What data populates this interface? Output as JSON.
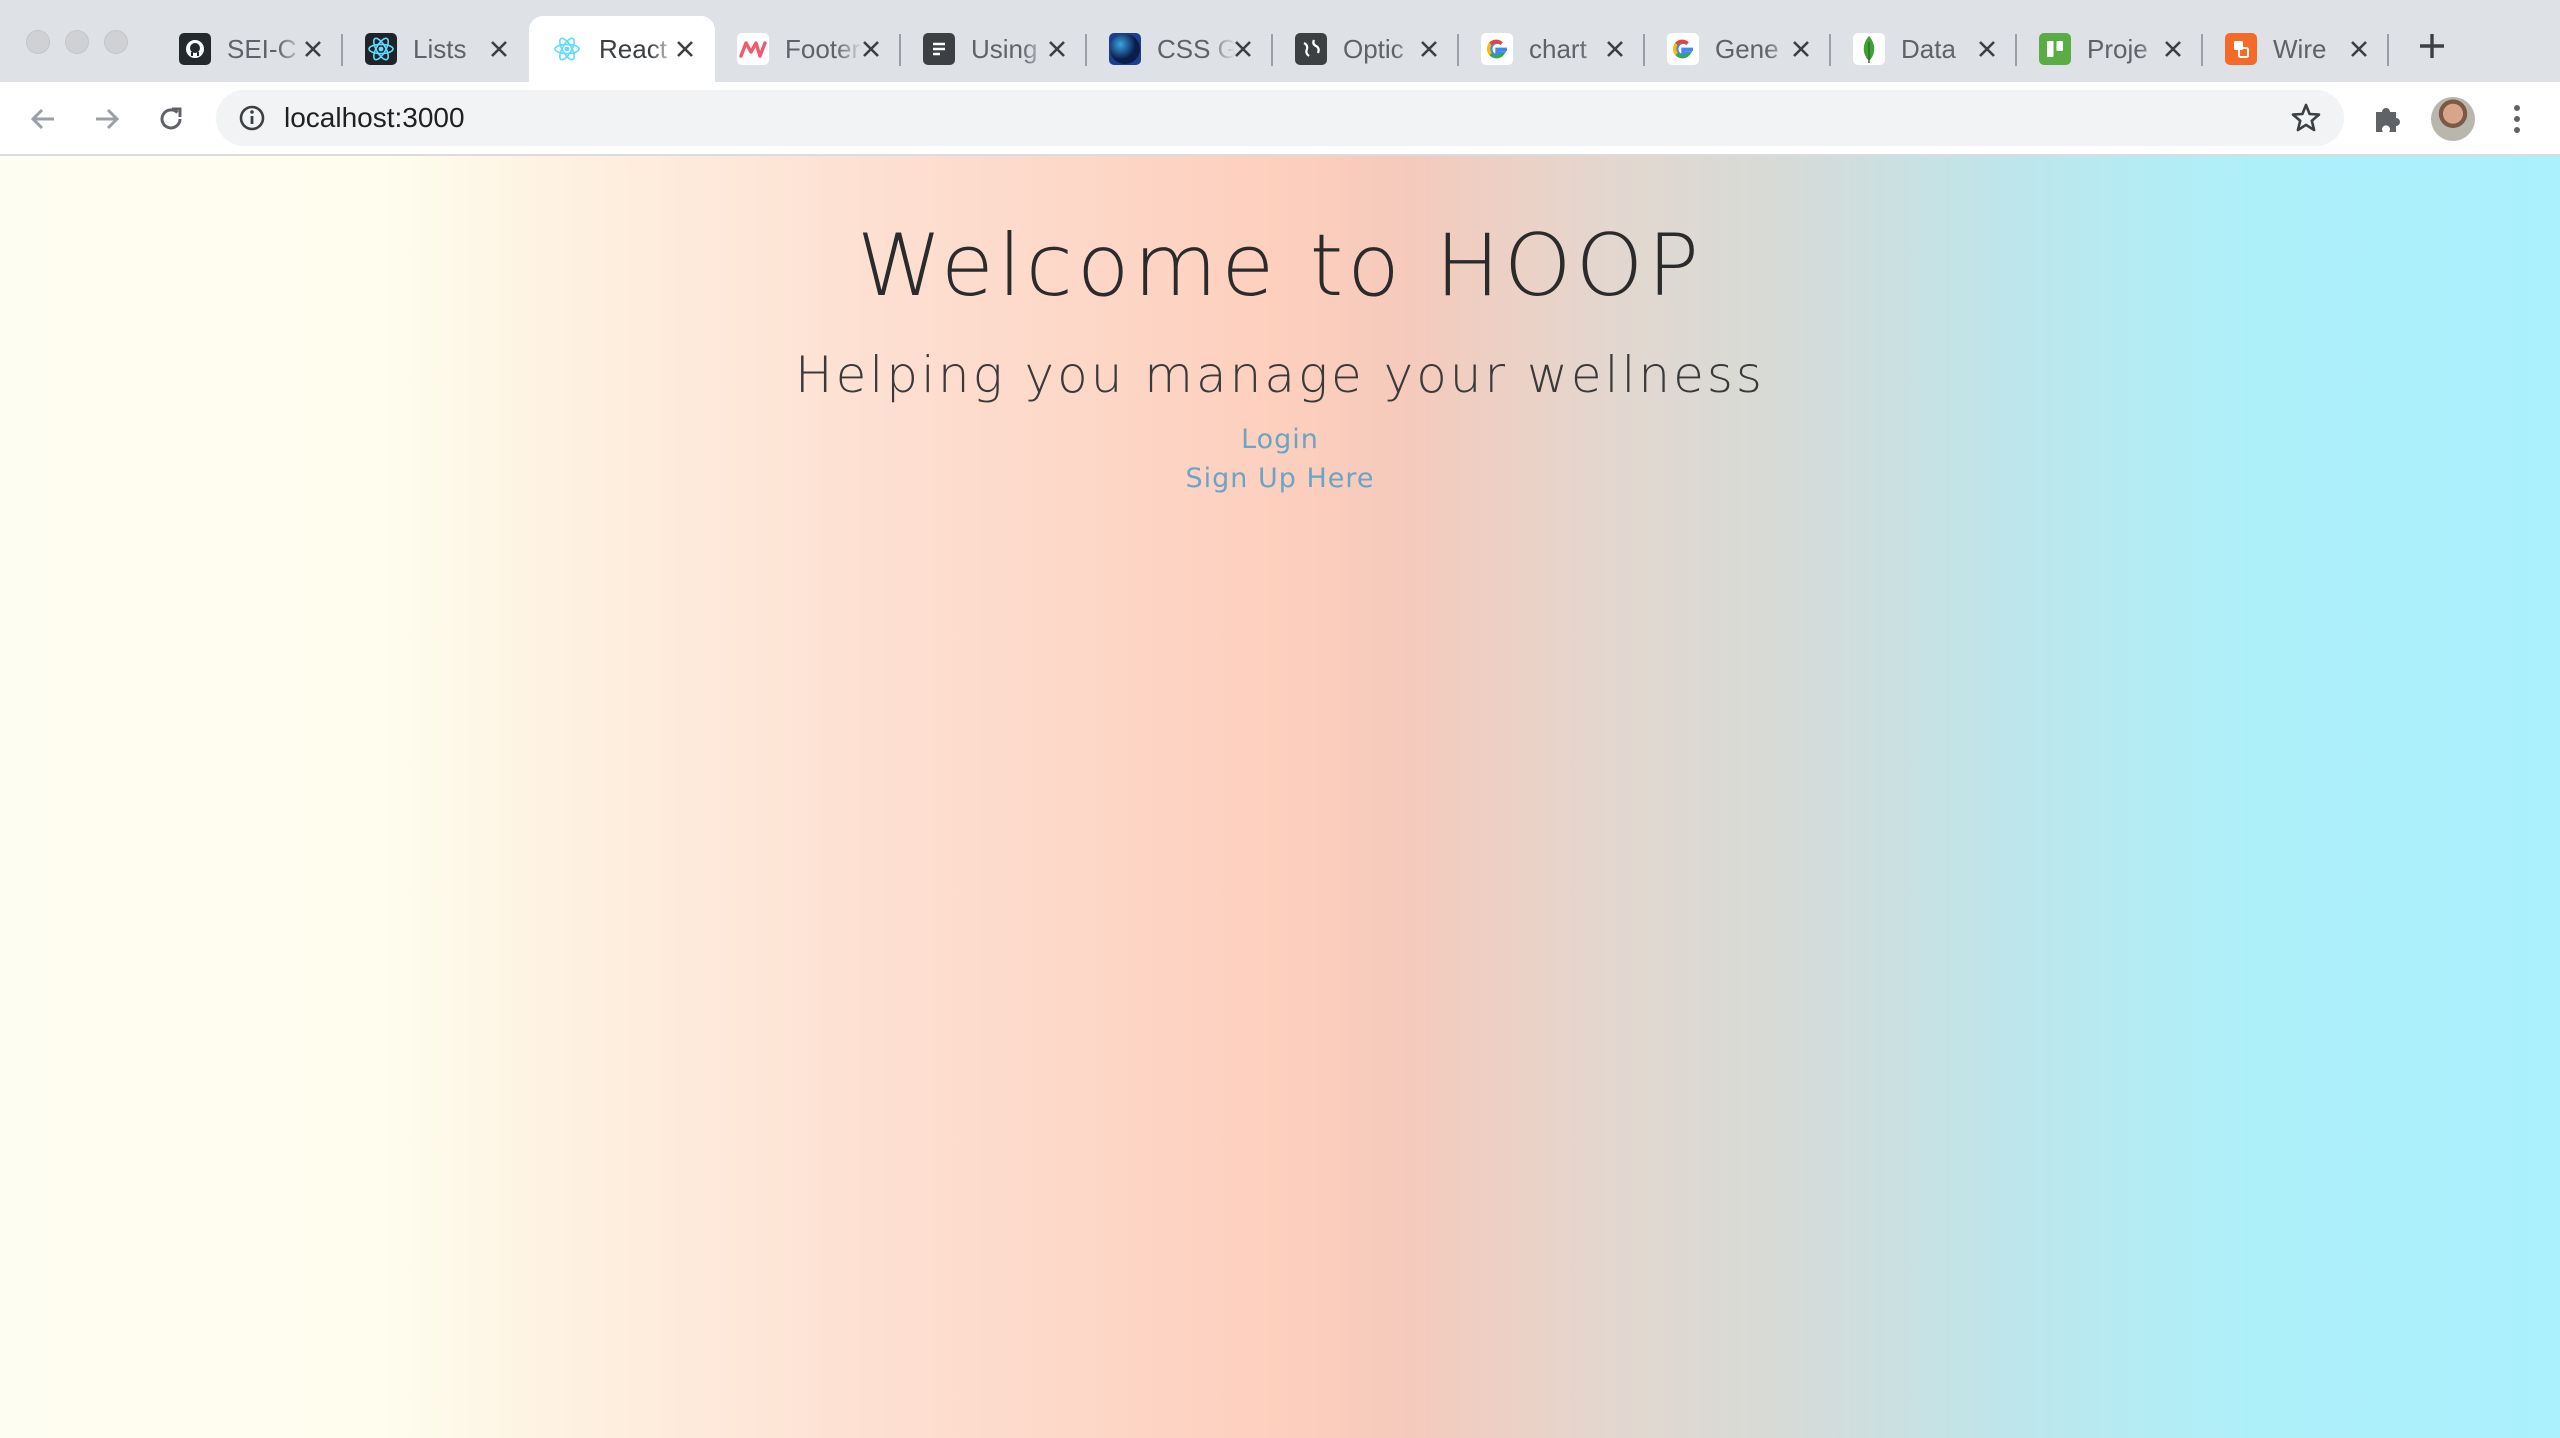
{
  "browser": {
    "tabs": [
      {
        "title": "SEI-C",
        "icon": "github-icon",
        "icon_bg": "#24292e",
        "active": false
      },
      {
        "title": "Lists",
        "icon": "react-icon",
        "icon_bg": "#20232a",
        "active": false
      },
      {
        "title": "React",
        "icon": "react-icon",
        "icon_bg": "#ffffff",
        "active": true
      },
      {
        "title": "Footer",
        "icon": "mui-icon",
        "icon_bg": "#ffffff",
        "active": false
      },
      {
        "title": "Using",
        "icon": "document-icon",
        "icon_bg": "#3c4043",
        "active": false
      },
      {
        "title": "CSS G",
        "icon": "css-orb-icon",
        "icon_bg": "#1b3f8f",
        "active": false
      },
      {
        "title": "Optic",
        "icon": "globe-icon",
        "icon_bg": "#3c4043",
        "active": false
      },
      {
        "title": "chart",
        "icon": "google-icon",
        "icon_bg": "#ffffff",
        "active": false
      },
      {
        "title": "Gene",
        "icon": "google-icon",
        "icon_bg": "#ffffff",
        "active": false
      },
      {
        "title": "Data",
        "icon": "mongodb-leaf-icon",
        "icon_bg": "#ffffff",
        "active": false
      },
      {
        "title": "Proje",
        "icon": "trello-icon",
        "icon_bg": "#5aac44",
        "active": false
      },
      {
        "title": "Wire",
        "icon": "wireframe-icon",
        "icon_bg": "#f26b2a",
        "active": false
      }
    ],
    "url": "localhost:3000"
  },
  "page": {
    "title": "Welcome to HOOP",
    "subtitle": "Helping you manage your wellness",
    "login_link": "Login",
    "signup_link": "Sign Up Here"
  }
}
